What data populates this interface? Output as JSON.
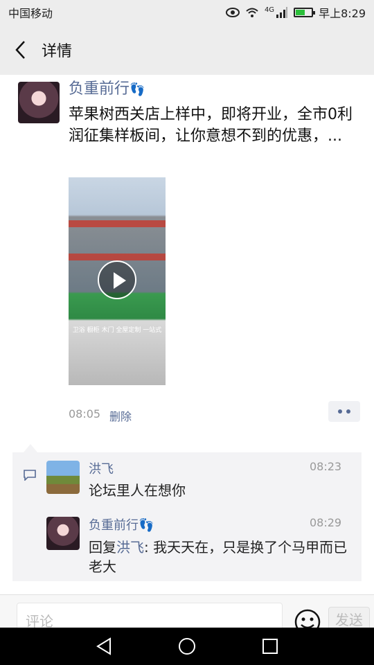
{
  "status_bar": {
    "carrier": "中国移动",
    "network": "4G",
    "time": "早上8:29",
    "battery_level": 0.55
  },
  "header": {
    "title": "详情"
  },
  "post": {
    "author": "负重前行",
    "author_emoji": "👣",
    "text": "苹果树西关店上样中，即将开业，全市0利润征集样板间，让你意想不到的优惠，...",
    "video_sign": "卫浴 橱柜 木门 全屋定制 一站式",
    "time": "08:05",
    "delete_label": "删除"
  },
  "comments": [
    {
      "name": "洪飞",
      "time": "08:23",
      "text": "论坛里人在想你"
    },
    {
      "name": "负重前行",
      "name_emoji": "👣",
      "time": "08:29",
      "reply_prefix": "回复",
      "reply_to": "洪飞",
      "text": ": 我天天在，只是换了个马甲而已老大"
    }
  ],
  "comment_bar": {
    "placeholder": "评论",
    "send_label": "发送"
  },
  "icons": {
    "back": "back-arrow-icon",
    "comment": "comment-bubble-icon",
    "emoji": "emoji-face-icon"
  },
  "colors": {
    "link": "#576b95",
    "background": "#ededed"
  }
}
